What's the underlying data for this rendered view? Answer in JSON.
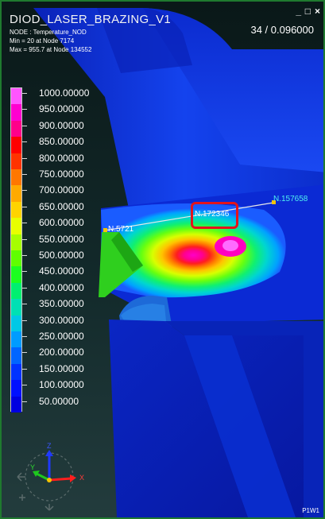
{
  "window": {
    "title": "DIOD_LASER_BRAZING_V1",
    "minimize_glyph": "_",
    "restore_glyph": "□",
    "close_glyph": "×",
    "step_readout": "34 / 0.096000"
  },
  "result_info": {
    "entity": "NODE : Temperature_NOD",
    "min": "Min = 20 at Node 7174",
    "max": "Max = 955.7 at Node 134552"
  },
  "legend": {
    "labels": [
      "1000.00000",
      "950.00000",
      "900.00000",
      "850.00000",
      "800.00000",
      "750.00000",
      "700.00000",
      "650.00000",
      "600.00000",
      "550.00000",
      "500.00000",
      "450.00000",
      "400.00000",
      "350.00000",
      "300.00000",
      "250.00000",
      "200.00000",
      "150.00000",
      "100.00000",
      "50.00000"
    ],
    "colors": [
      "#ff55ff",
      "#ff00d0",
      "#ff008a",
      "#ff0000",
      "#ff3300",
      "#ff7700",
      "#ffaa00",
      "#ffd400",
      "#e8ff00",
      "#a6ff00",
      "#60ff00",
      "#1cff20",
      "#00f070",
      "#00e0b4",
      "#00c8e6",
      "#009cff",
      "#0066ff",
      "#0033ff",
      "#0010ff",
      "#0000e0"
    ]
  },
  "probes": [
    {
      "label": "N.157658",
      "color": "#4ff0f0"
    },
    {
      "label": "N.172346",
      "color": "#ffffff"
    },
    {
      "label": "N.5721",
      "color": "#ffffff"
    }
  ],
  "corner_tag": "P1W1",
  "triad": {
    "x_label": "X",
    "y_label": "Y",
    "z_label": "Z"
  },
  "colors": {
    "frame": "#1f7a2f",
    "highlight": "#e3141b",
    "part_blue": "#0c2fd6"
  }
}
